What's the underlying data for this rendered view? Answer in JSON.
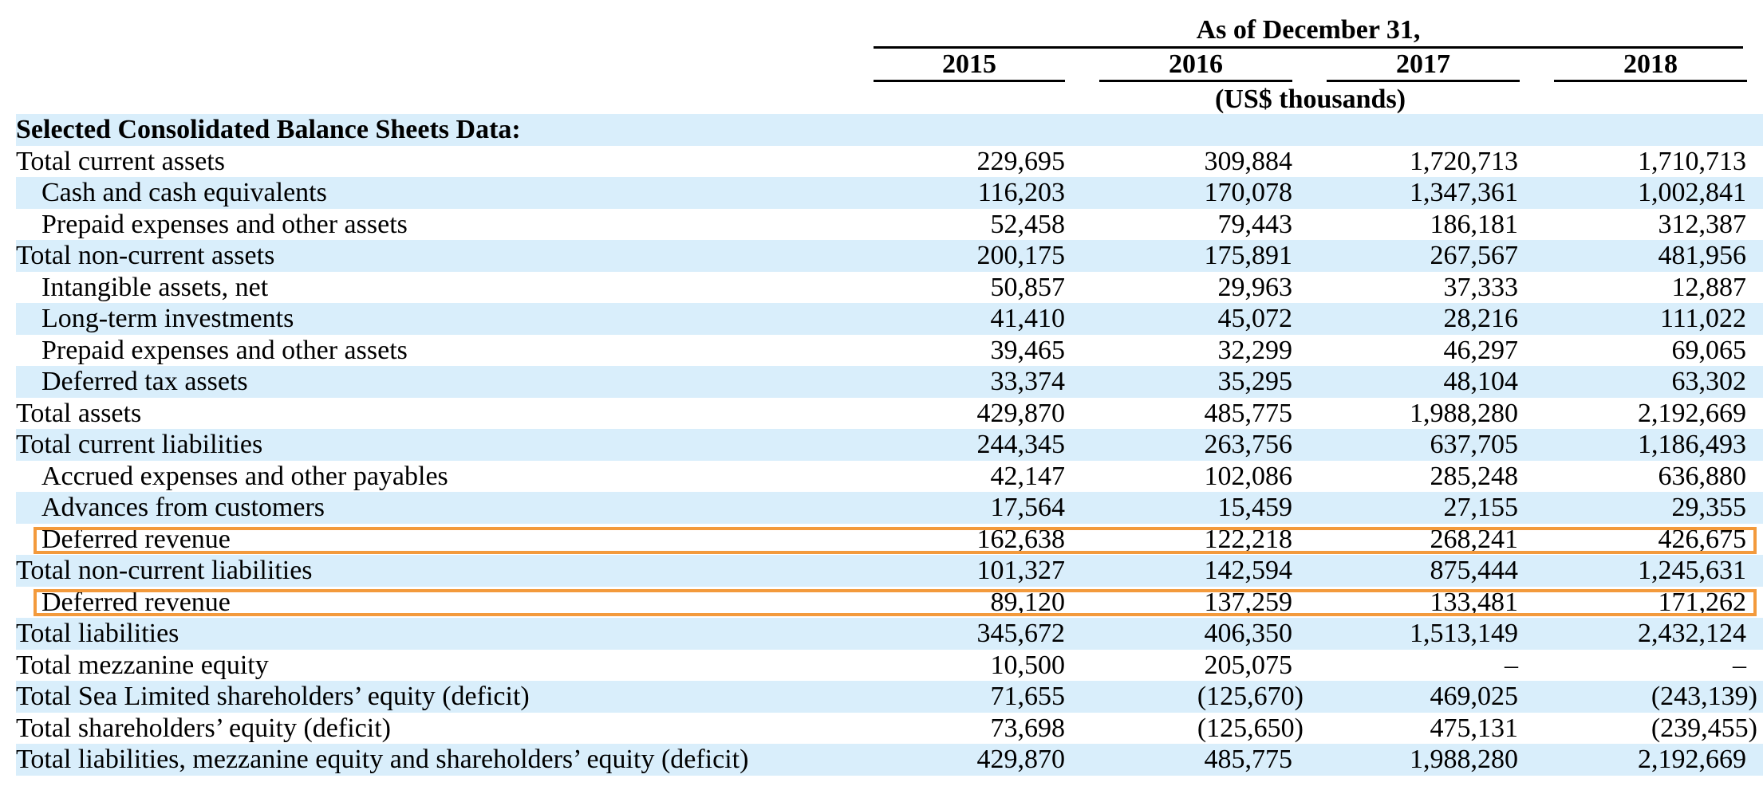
{
  "header": {
    "as_of": "As of December 31,",
    "years": [
      "2015",
      "2016",
      "2017",
      "2018"
    ],
    "units": "(US$ thousands)"
  },
  "rows": [
    {
      "label": "Selected Consolidated Balance Sheets Data:",
      "style": "section",
      "values": [
        "",
        "",
        "",
        ""
      ]
    },
    {
      "label": "Total current assets",
      "style": "top",
      "values": [
        "229,695",
        "309,884",
        "1,720,713",
        "1,710,713"
      ]
    },
    {
      "label": "Cash and cash equivalents",
      "style": "indent",
      "values": [
        "116,203",
        "170,078",
        "1,347,361",
        "1,002,841"
      ]
    },
    {
      "label": "Prepaid expenses and other assets",
      "style": "indent",
      "values": [
        "52,458",
        "79,443",
        "186,181",
        "312,387"
      ]
    },
    {
      "label": "Total non-current assets",
      "style": "top",
      "values": [
        "200,175",
        "175,891",
        "267,567",
        "481,956"
      ]
    },
    {
      "label": "Intangible assets, net",
      "style": "indent",
      "values": [
        "50,857",
        "29,963",
        "37,333",
        "12,887"
      ]
    },
    {
      "label": "Long-term investments",
      "style": "indent",
      "values": [
        "41,410",
        "45,072",
        "28,216",
        "111,022"
      ]
    },
    {
      "label": "Prepaid expenses and other assets",
      "style": "indent",
      "values": [
        "39,465",
        "32,299",
        "46,297",
        "69,065"
      ]
    },
    {
      "label": "Deferred tax assets",
      "style": "indent",
      "values": [
        "33,374",
        "35,295",
        "48,104",
        "63,302"
      ]
    },
    {
      "label": "Total assets",
      "style": "top",
      "values": [
        "429,870",
        "485,775",
        "1,988,280",
        "2,192,669"
      ]
    },
    {
      "label": "Total current liabilities",
      "style": "top",
      "values": [
        "244,345",
        "263,756",
        "637,705",
        "1,186,493"
      ]
    },
    {
      "label": "Accrued expenses and other payables",
      "style": "indent",
      "values": [
        "42,147",
        "102,086",
        "285,248",
        "636,880"
      ]
    },
    {
      "label": "Advances from customers",
      "style": "indent",
      "values": [
        "17,564",
        "15,459",
        "27,155",
        "29,355"
      ]
    },
    {
      "label": "Deferred revenue",
      "style": "indent",
      "values": [
        "162,638",
        "122,218",
        "268,241",
        "426,675"
      ]
    },
    {
      "label": "Total non-current liabilities",
      "style": "top",
      "values": [
        "101,327",
        "142,594",
        "875,444",
        "1,245,631"
      ]
    },
    {
      "label": "Deferred revenue",
      "style": "indent",
      "values": [
        "89,120",
        "137,259",
        "133,481",
        "171,262"
      ]
    },
    {
      "label": "Total liabilities",
      "style": "top",
      "values": [
        "345,672",
        "406,350",
        "1,513,149",
        "2,432,124"
      ]
    },
    {
      "label": "Total mezzanine equity",
      "style": "top",
      "values": [
        "10,500",
        "205,075",
        "–",
        "–"
      ]
    },
    {
      "label": "Total Sea Limited shareholders’ equity (deficit)",
      "style": "top",
      "values": [
        "71,655",
        "(125,670)",
        "469,025",
        "(243,139)"
      ]
    },
    {
      "label": "Total shareholders’ equity (deficit)",
      "style": "top",
      "values": [
        "73,698",
        "(125,650)",
        "475,131",
        "(239,455)"
      ]
    },
    {
      "label": "Total liabilities, mezzanine equity and shareholders’ equity (deficit)",
      "style": "top",
      "values": [
        "429,870",
        "485,775",
        "1,988,280",
        "2,192,669"
      ]
    }
  ],
  "highlight_color": "#f39a3c",
  "shade_color": "#d9eefb"
}
